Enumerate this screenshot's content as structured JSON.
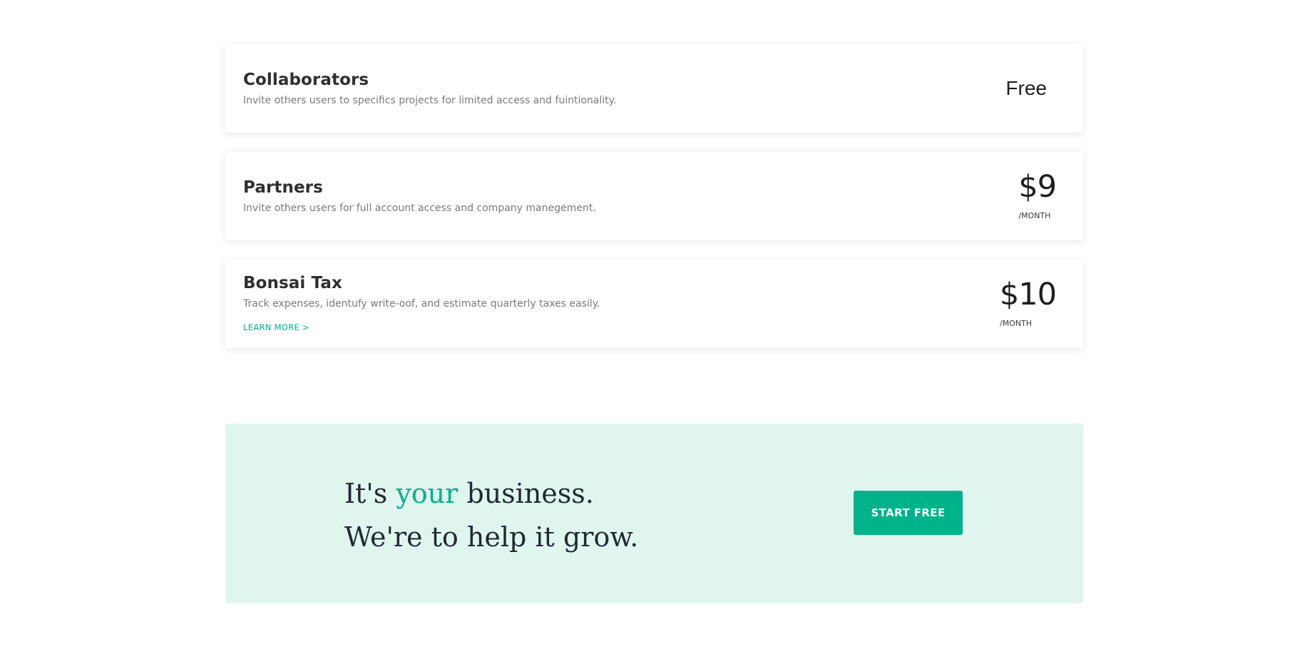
{
  "addons": [
    {
      "name": "Collaborators",
      "description": "Invite others users to specifics projects for limited access and fuintionality.",
      "price": "Free",
      "period": ""
    },
    {
      "name": "Partners",
      "description": "Invite others users for full account access and company manegement.",
      "price": "$9",
      "period": "/MONTH"
    },
    {
      "name": "Bonsai Tax",
      "description": "Track expenses, identufy write-oof, and estimate quarterly taxes easily.",
      "price": "$10",
      "period": "/MONTH",
      "link_label": "LEARN MORE >"
    }
  ],
  "cta": {
    "line1_prefix": "It's ",
    "line1_accent": "your",
    "line1_suffix": " business.",
    "line2": "We're to help it grow.",
    "button_label": "START FREE"
  },
  "colors": {
    "accent": "#00b289",
    "cta_background": "#e1f5ef"
  }
}
